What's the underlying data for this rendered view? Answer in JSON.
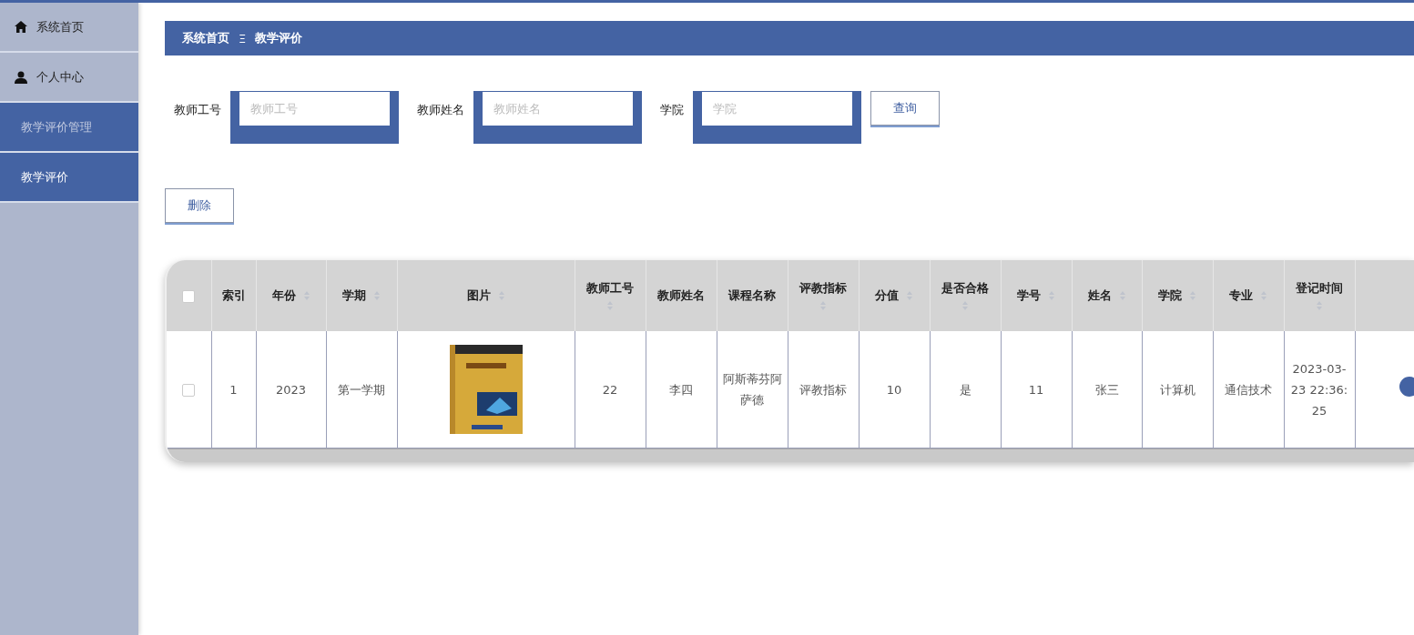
{
  "sidebar": {
    "items": [
      {
        "label": "系统首页",
        "kind": "home",
        "selected": false
      },
      {
        "label": "个人中心",
        "kind": "user",
        "selected": false
      },
      {
        "label": "教学评价管理",
        "kind": "group",
        "selected": true
      },
      {
        "label": "教学评价",
        "kind": "sub",
        "selected": true
      }
    ]
  },
  "breadcrumb": {
    "items": [
      "系统首页",
      "教学评价"
    ],
    "separator": "Ξ"
  },
  "search": {
    "fields": [
      {
        "label": "教师工号",
        "placeholder": "教师工号"
      },
      {
        "label": "教师姓名",
        "placeholder": "教师姓名"
      },
      {
        "label": "学院",
        "placeholder": "学院"
      }
    ],
    "button": "查询"
  },
  "delete_button": "删除",
  "table": {
    "columns": [
      {
        "kind": "checkbox",
        "sortable": false,
        "checked": false
      },
      {
        "label": "索引",
        "kind": "text",
        "sortable": false
      },
      {
        "label": "年份",
        "kind": "text",
        "sortable": true
      },
      {
        "label": "学期",
        "kind": "text",
        "sortable": true
      },
      {
        "label": "图片",
        "sortable": true
      },
      {
        "label": "教师工号",
        "kind": "text",
        "sortable": true
      },
      {
        "label": "教师姓名",
        "kind": "text",
        "sortable": false
      },
      {
        "label": "课程名称",
        "kind": "text",
        "sortable": false
      },
      {
        "label": "评教指标",
        "kind": "text",
        "sortable": true
      },
      {
        "label": "分值",
        "kind": "text",
        "sortable": true
      },
      {
        "label": "是否合格",
        "kind": "text",
        "sortable": true
      },
      {
        "label": "学号",
        "kind": "text",
        "sortable": true
      },
      {
        "label": "姓名",
        "kind": "text",
        "sortable": true
      },
      {
        "label": "学院",
        "kind": "text",
        "sortable": true
      },
      {
        "label": "专业",
        "kind": "text",
        "sortable": true
      },
      {
        "label": "登记时间",
        "kind": "text",
        "sortable": true
      },
      {
        "kind": "action",
        "sortable": false
      }
    ],
    "rows": [
      {
        "checked": false,
        "cells": [
          "",
          "1",
          "2023",
          "第一学期",
          "",
          "22",
          "李四",
          "阿斯蒂芬阿萨德",
          "评教指标",
          "10",
          "是",
          "11",
          "张三",
          "计算机",
          "通信技术",
          "2023-03-23 22:36:25",
          ""
        ]
      }
    ]
  }
}
